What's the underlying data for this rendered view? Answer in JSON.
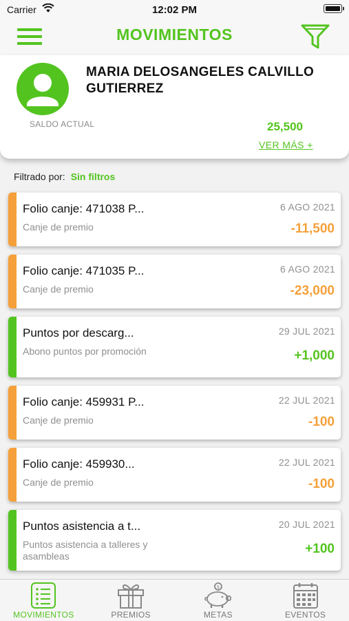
{
  "status_bar": {
    "carrier": "Carrier",
    "time": "12:02 PM"
  },
  "header": {
    "title": "MOVIMIENTOS",
    "menu_icon": "hamburger-menu-icon",
    "filter_icon": "filter-funnel-icon"
  },
  "profile": {
    "name": "MARIA DELOSANGELES CALVILLO GUTIERREZ",
    "saldo_label": "SALDO ACTUAL",
    "saldo_value": "25,500",
    "ver_mas": "VER MÁS +"
  },
  "filter": {
    "label": "Filtrado por:",
    "value": "Sin filtros"
  },
  "transactions": [
    {
      "title": "Folio canje: 471038 P...",
      "subtitle": "Canje de premio",
      "date": "6 AGO 2021",
      "amount": "-11,500",
      "type": "canje"
    },
    {
      "title": "Folio canje: 471035 P...",
      "subtitle": "Canje de premio",
      "date": "6 AGO 2021",
      "amount": "-23,000",
      "type": "canje"
    },
    {
      "title": "Puntos por descarg...",
      "subtitle": "Abono puntos por promoción",
      "date": "29 JUL 2021",
      "amount": "+1,000",
      "type": "abono"
    },
    {
      "title": "Folio canje: 459931 P...",
      "subtitle": "Canje de premio",
      "date": "22 JUL 2021",
      "amount": "-100",
      "type": "canje"
    },
    {
      "title": "Folio canje: 459930...",
      "subtitle": "Canje de premio",
      "date": "22 JUL 2021",
      "amount": "-100",
      "type": "canje"
    },
    {
      "title": "Puntos asistencia a t...",
      "subtitle": "Puntos asistencia a talleres y asambleas",
      "date": "20 JUL 2021",
      "amount": "+100",
      "type": "abono"
    }
  ],
  "tabs": [
    {
      "label": "MOVIMIENTOS",
      "icon": "list-icon",
      "active": true
    },
    {
      "label": "PREMIOS",
      "icon": "gift-icon",
      "active": false
    },
    {
      "label": "METAS",
      "icon": "piggy-bank-icon",
      "active": false
    },
    {
      "label": "EVENTOS",
      "icon": "calendar-icon",
      "active": false
    }
  ],
  "colors": {
    "brand_green": "#53c41f",
    "canje_orange": "#f5a03a",
    "abono_green": "#53c41f"
  }
}
